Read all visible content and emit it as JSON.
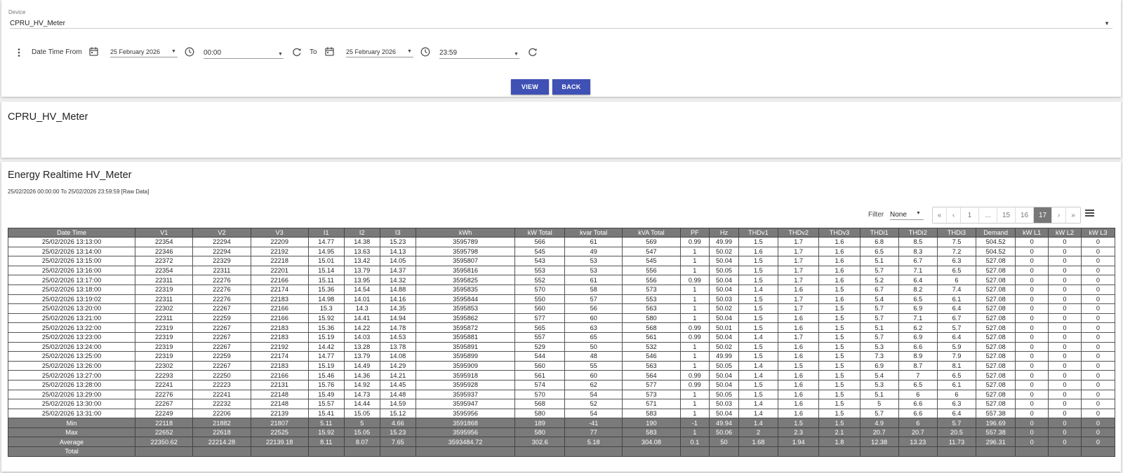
{
  "device": {
    "label": "Device",
    "value": "CPRU_HV_Meter"
  },
  "range": {
    "from_label": "Date Time From",
    "from_date": "25 February 2026",
    "from_time": "00:00",
    "to_label": "To",
    "to_date": "25 February 2026",
    "to_time": "23:59"
  },
  "buttons": {
    "view": "VIEW",
    "back": "BACK"
  },
  "device_title": "CPRU_HV_Meter",
  "report": {
    "title": "Energy Realtime HV_Meter",
    "subtitle": "25/02/2026 00:00:00 To 25/02/2026 23:59:59 [Raw Data]"
  },
  "filter": {
    "label": "Filter",
    "value": "None"
  },
  "pager": {
    "items": [
      "«",
      "‹",
      "1",
      "...",
      "15",
      "16",
      "17",
      "›",
      "»"
    ],
    "active": "17"
  },
  "icons": [
    "more-vert-icon",
    "calendar-icon",
    "clock-icon",
    "refresh-icon",
    "chevron-down-icon",
    "menu-icon"
  ],
  "colors": {
    "accent": "#3f51b5",
    "header_bg": "#7a7a7a"
  },
  "table": {
    "headers": [
      "Date Time",
      "V1",
      "V2",
      "V3",
      "I1",
      "I2",
      "I3",
      "kWh",
      "kW Total",
      "kvar Total",
      "kVA Total",
      "PF",
      "Hz",
      "THDv1",
      "THDv2",
      "THDv3",
      "THDi1",
      "THDi2",
      "THDi3",
      "Demand",
      "kW L1",
      "kW L2",
      "kW L3"
    ],
    "rows": [
      [
        "25/02/2026 13:13:00",
        "22354",
        "22294",
        "22209",
        "14.77",
        "14.38",
        "15.23",
        "3595789",
        "566",
        "61",
        "569",
        "0.99",
        "49.99",
        "1.5",
        "1.7",
        "1.6",
        "6.8",
        "8.5",
        "7.5",
        "504.52",
        "0",
        "0",
        "0"
      ],
      [
        "25/02/2026 13:14:00",
        "22346",
        "22294",
        "22192",
        "14.95",
        "13.63",
        "14.13",
        "3595798",
        "545",
        "49",
        "547",
        "1",
        "50.02",
        "1.6",
        "1.7",
        "1.6",
        "6.5",
        "8.3",
        "7.2",
        "504.52",
        "0",
        "0",
        "0"
      ],
      [
        "25/02/2026 13:15:00",
        "22372",
        "22329",
        "22218",
        "15.01",
        "13.42",
        "14.05",
        "3595807",
        "543",
        "53",
        "545",
        "1",
        "50.04",
        "1.5",
        "1.7",
        "1.6",
        "5.1",
        "6.7",
        "6.3",
        "527.08",
        "0",
        "0",
        "0"
      ],
      [
        "25/02/2026 13:16:00",
        "22354",
        "22311",
        "22201",
        "15.14",
        "13.79",
        "14.37",
        "3595816",
        "553",
        "53",
        "556",
        "1",
        "50.05",
        "1.5",
        "1.7",
        "1.6",
        "5.7",
        "7.1",
        "6.5",
        "527.08",
        "0",
        "0",
        "0"
      ],
      [
        "25/02/2026 13:17:00",
        "22311",
        "22276",
        "22166",
        "15.11",
        "13.95",
        "14.32",
        "3595825",
        "552",
        "61",
        "556",
        "0.99",
        "50.04",
        "1.5",
        "1.7",
        "1.6",
        "5.2",
        "6.4",
        "6",
        "527.08",
        "0",
        "0",
        "0"
      ],
      [
        "25/02/2026 13:18:00",
        "22319",
        "22276",
        "22174",
        "15.36",
        "14.54",
        "14.88",
        "3595835",
        "570",
        "58",
        "573",
        "1",
        "50.04",
        "1.4",
        "1.6",
        "1.5",
        "6.7",
        "8.2",
        "7.4",
        "527.08",
        "0",
        "0",
        "0"
      ],
      [
        "25/02/2026 13:19:02",
        "22311",
        "22276",
        "22183",
        "14.98",
        "14.01",
        "14.16",
        "3595844",
        "550",
        "57",
        "553",
        "1",
        "50.03",
        "1.5",
        "1.7",
        "1.6",
        "5.4",
        "6.5",
        "6.1",
        "527.08",
        "0",
        "0",
        "0"
      ],
      [
        "25/02/2026 13:20:00",
        "22302",
        "22267",
        "22166",
        "15.3",
        "14.3",
        "14.35",
        "3595853",
        "560",
        "56",
        "563",
        "1",
        "50.02",
        "1.5",
        "1.7",
        "1.5",
        "5.7",
        "6.9",
        "6.4",
        "527.08",
        "0",
        "0",
        "0"
      ],
      [
        "25/02/2026 13:21:00",
        "22311",
        "22259",
        "22166",
        "15.92",
        "14.41",
        "14.94",
        "3595862",
        "577",
        "60",
        "580",
        "1",
        "50.04",
        "1.5",
        "1.6",
        "1.5",
        "5.7",
        "7.1",
        "6.7",
        "527.08",
        "0",
        "0",
        "0"
      ],
      [
        "25/02/2026 13:22:00",
        "22319",
        "22267",
        "22183",
        "15.36",
        "14.22",
        "14.78",
        "3595872",
        "565",
        "63",
        "568",
        "0.99",
        "50.01",
        "1.5",
        "1.6",
        "1.5",
        "5.1",
        "6.2",
        "5.7",
        "527.08",
        "0",
        "0",
        "0"
      ],
      [
        "25/02/2026 13:23:00",
        "22319",
        "22267",
        "22183",
        "15.19",
        "14.03",
        "14.53",
        "3595881",
        "557",
        "65",
        "561",
        "0.99",
        "50.04",
        "1.4",
        "1.7",
        "1.5",
        "5.7",
        "6.9",
        "6.4",
        "527.08",
        "0",
        "0",
        "0"
      ],
      [
        "25/02/2026 13:24:00",
        "22319",
        "22267",
        "22192",
        "14.42",
        "13.28",
        "13.78",
        "3595891",
        "529",
        "50",
        "532",
        "1",
        "50.02",
        "1.5",
        "1.6",
        "1.5",
        "5.3",
        "6.6",
        "5.9",
        "527.08",
        "0",
        "0",
        "0"
      ],
      [
        "25/02/2026 13:25:00",
        "22319",
        "22259",
        "22174",
        "14.77",
        "13.79",
        "14.08",
        "3595899",
        "544",
        "48",
        "546",
        "1",
        "49.99",
        "1.5",
        "1.6",
        "1.5",
        "7.3",
        "8.9",
        "7.9",
        "527.08",
        "0",
        "0",
        "0"
      ],
      [
        "25/02/2026 13:26:00",
        "22302",
        "22267",
        "22183",
        "15.19",
        "14.49",
        "14.29",
        "3595909",
        "560",
        "55",
        "563",
        "1",
        "50.05",
        "1.4",
        "1.5",
        "1.5",
        "6.9",
        "8.7",
        "8.1",
        "527.08",
        "0",
        "0",
        "0"
      ],
      [
        "25/02/2026 13:27:00",
        "22293",
        "22250",
        "22166",
        "15.46",
        "14.36",
        "14.21",
        "3595918",
        "561",
        "60",
        "564",
        "0.99",
        "50.04",
        "1.4",
        "1.6",
        "1.5",
        "5.4",
        "7",
        "6.5",
        "527.08",
        "0",
        "0",
        "0"
      ],
      [
        "25/02/2026 13:28:00",
        "22241",
        "22223",
        "22131",
        "15.76",
        "14.92",
        "14.45",
        "3595928",
        "574",
        "62",
        "577",
        "0.99",
        "50.04",
        "1.5",
        "1.6",
        "1.5",
        "5.3",
        "6.5",
        "6.1",
        "527.08",
        "0",
        "0",
        "0"
      ],
      [
        "25/02/2026 13:29:00",
        "22276",
        "22241",
        "22148",
        "15.49",
        "14.73",
        "14.48",
        "3595937",
        "570",
        "54",
        "573",
        "1",
        "50.05",
        "1.5",
        "1.6",
        "1.5",
        "5.1",
        "6",
        "6",
        "527.08",
        "0",
        "0",
        "0"
      ],
      [
        "25/02/2026 13:30:00",
        "22267",
        "22232",
        "22148",
        "15.57",
        "14.44",
        "14.59",
        "3595947",
        "568",
        "52",
        "571",
        "1",
        "50.03",
        "1.4",
        "1.6",
        "1.5",
        "5",
        "6.6",
        "6.3",
        "527.08",
        "0",
        "0",
        "0"
      ],
      [
        "25/02/2026 13:31:00",
        "22249",
        "22206",
        "22139",
        "15.41",
        "15.05",
        "15.12",
        "3595956",
        "580",
        "54",
        "583",
        "1",
        "50.04",
        "1.4",
        "1.6",
        "1.5",
        "5.7",
        "6.6",
        "6.4",
        "557.38",
        "0",
        "0",
        "0"
      ]
    ],
    "summary": [
      [
        "Min",
        "22118",
        "21882",
        "21807",
        "5.11",
        "5",
        "4.66",
        "3591868",
        "189",
        "-41",
        "190",
        "-1",
        "49.94",
        "1.4",
        "1.5",
        "1.5",
        "4.9",
        "6",
        "5.7",
        "196.69",
        "0",
        "0",
        "0"
      ],
      [
        "Max",
        "22652",
        "22618",
        "22525",
        "15.92",
        "15.05",
        "15.23",
        "3595956",
        "580",
        "77",
        "583",
        "1",
        "50.06",
        "2",
        "2.3",
        "2.1",
        "20.7",
        "20.7",
        "20.5",
        "557.38",
        "0",
        "0",
        "0"
      ],
      [
        "Average",
        "22350.62",
        "22214.28",
        "22139.18",
        "8.11",
        "8.07",
        "7.65",
        "3593484.72",
        "302.6",
        "5.18",
        "304.08",
        "0.1",
        "50",
        "1.68",
        "1.94",
        "1.8",
        "12.38",
        "13.23",
        "11.73",
        "296.31",
        "0",
        "0",
        "0"
      ],
      [
        "Total",
        "",
        "",
        "",
        "",
        "",
        "",
        "",
        "",
        "",
        "",
        "",
        "",
        "",
        "",
        "",
        "",
        "",
        "",
        "",
        "",
        "",
        ""
      ]
    ]
  }
}
